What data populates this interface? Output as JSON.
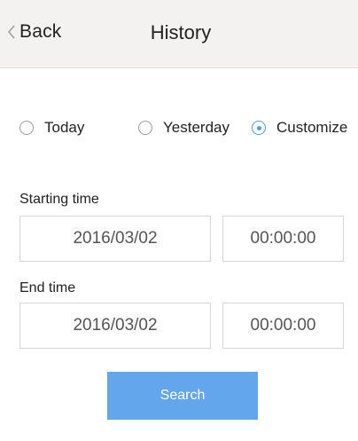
{
  "header": {
    "back_label": "Back",
    "title": "History"
  },
  "range_options": [
    {
      "label": "Today",
      "checked": false
    },
    {
      "label": "Yesterday",
      "checked": false
    },
    {
      "label": "Customize",
      "checked": true
    }
  ],
  "start": {
    "label": "Starting time",
    "date": "2016/03/02",
    "time": "00:00:00"
  },
  "end": {
    "label": "End time",
    "date": "2016/03/02",
    "time": "00:00:00"
  },
  "search_label": "Search",
  "colors": {
    "accent": "#4f9be8",
    "button": "#64a6ec",
    "header_bg": "#f3f2f0"
  },
  "icons": {
    "back": "chevron-left-icon"
  }
}
